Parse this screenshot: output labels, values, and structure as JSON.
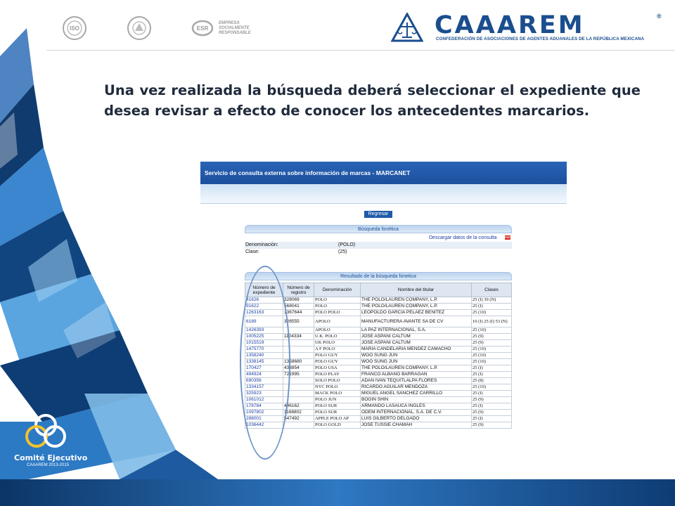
{
  "header": {
    "certifications": [
      {
        "icon": "iso-seal-icon",
        "text": ""
      },
      {
        "icon": "ribbon-seal-icon",
        "text": ""
      },
      {
        "icon": "esr-logo-icon",
        "text": "EMPRESA SOCIALMENTE RESPONSABLE"
      }
    ],
    "brand": {
      "name": "CAAAREM",
      "registered": "®",
      "subtitle": "CONFEDERACIÓN DE ASOCIACIONES DE AGENTES ADUANALES DE LA REPÚBLICA MEXICANA"
    }
  },
  "main_text": "Una vez realizada la búsqueda deberá seleccionar el expediente que desea revisar a efecto de conocer los antecedentes marcarios.",
  "screenshot": {
    "title": "Servicio de consulta externa sobre información de marcas - MARCANET",
    "back_button": "Regresar",
    "search_panel": {
      "title": "Búsqueda fonética",
      "download_link": "Descargar datos de la consulta",
      "pdf_label": "PDF",
      "rows": [
        {
          "label": "Denominación:",
          "value": "(POLO)"
        },
        {
          "label": "Clase:",
          "value": "(25)"
        }
      ]
    },
    "results_panel": {
      "title": "Resultado de la búsqueda fonetica",
      "columns": [
        "Número de expediente",
        "Número de registro",
        "Denominación",
        "Nombre del titular",
        "Clases"
      ],
      "rows": [
        [
          "41626",
          "328069",
          "POLO",
          "THE POLO/LAUREN COMPANY, L.P.",
          "25 (I) 39 (N)"
        ],
        [
          "91622",
          "568041",
          "POLO",
          "THE POLO/LAUREN COMPANY, L.P.",
          "25 (I)"
        ],
        [
          "1263163",
          "1367644",
          "POLO POLO",
          "LEOPOLDO GARCIA PELAEZ BENITEZ",
          "25 (10)"
        ],
        [
          "6189",
          "328555",
          "APOLO",
          "MANUFACTURERA AVANTE SA DE CV",
          "10 (I) 25 (I) 53 (N)"
        ],
        [
          "1426393",
          "",
          "APOLO",
          "LA PAZ INTERNACIONAL, S.A.",
          "25 (10)"
        ],
        [
          "1005225",
          "1104334",
          "U.K. POLO",
          "JOSE ASPANI CALTUM",
          "25 (9)"
        ],
        [
          "1015519",
          "",
          "UK POLO",
          "JOSE ASPANI CALTUM",
          "25 (9)"
        ],
        [
          "1475770",
          "",
          "A F POLO",
          "MARIA CANDELARIA MENDEZ CAMACHO",
          "25 (10)"
        ],
        [
          "1358240",
          "",
          "POLO GUY",
          "WOO SUNG JUN",
          "25 (10)"
        ],
        [
          "1338145",
          "1358680",
          "POLO GUY",
          "WOO SUNG JUN",
          "25 (10)"
        ],
        [
          "170427",
          "438854",
          "POLO USA",
          "THE POLO/LAUREN COMPANY, L.P.",
          "25 (I)"
        ],
        [
          "494924",
          "721995",
          "POLO PLAY",
          "FRANCO ALBANO BARRAGAN",
          "25 (I)"
        ],
        [
          "690356",
          "",
          "SOLO POLO",
          "ADAN IVAN TEQUITLALPA FLORES",
          "25 (8)"
        ],
        [
          "1334157",
          "",
          "NYC POLO",
          "RICARDO AGUILAR MENDOZA",
          "25 (10)"
        ],
        [
          "325923",
          "",
          "MACK POLO",
          "MIGUEL ANGEL SANCHEZ CARRILLO",
          "25 (I)"
        ],
        [
          "1061012",
          "",
          "POLO JUN",
          "BOGIN SHIN",
          "25 (9)"
        ],
        [
          "178784",
          "446162",
          "POLO SUR",
          "ARMANDO LASAUCA INGLES",
          "25 (I)"
        ],
        [
          "1097802",
          "1168802",
          "POLO SUR",
          "ODEM INTERNACIONAL, S.A. DE C.V.",
          "25 (9)"
        ],
        [
          "288001",
          "547492",
          "APPLE POLO AP",
          "LUIS GILBERTO DELGADO",
          "25 (I)"
        ],
        [
          "1036442",
          "",
          "POLO GOLD",
          "JOSE TUSSIE CHAMAH",
          "25 (9)"
        ]
      ]
    }
  },
  "footer_logo": {
    "name": "Comité Ejecutivo",
    "subtitle": "CAAAREM 2013-2015"
  }
}
